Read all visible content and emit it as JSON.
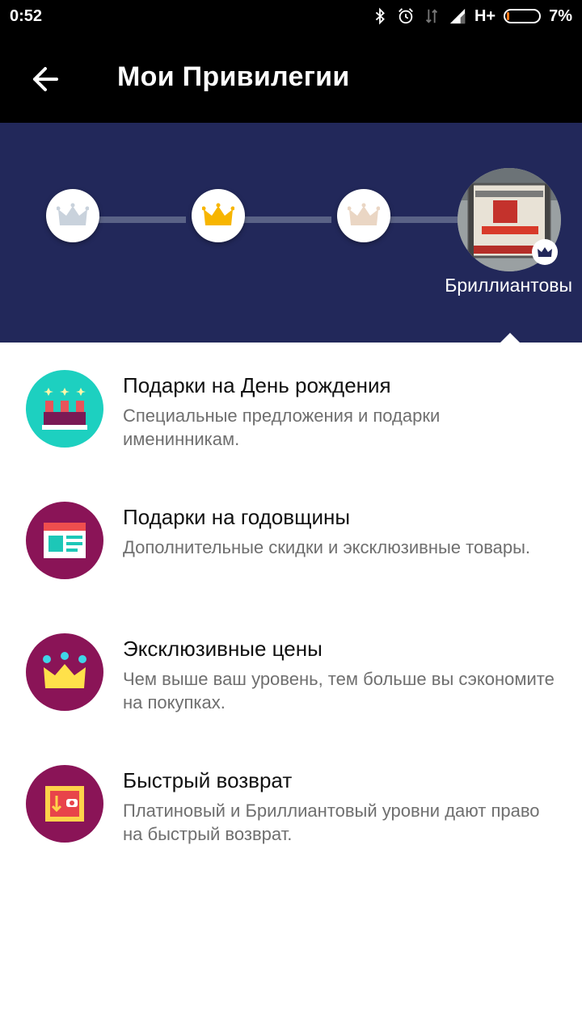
{
  "status_bar": {
    "time": "0:52",
    "network": "H+",
    "battery": "7%",
    "battery_level": 0.07,
    "icons": [
      "bluetooth-icon",
      "alarm-icon",
      "data-arrows-icon",
      "signal-icon",
      "battery-icon"
    ]
  },
  "app_bar": {
    "title": "Мои Привилегии",
    "back_icon": "arrow-left-icon"
  },
  "tiers": {
    "current_label": "Бриллиантовы",
    "nodes": [
      {
        "icon": "crown-silver-icon",
        "color": "#c9d2dc"
      },
      {
        "icon": "crown-gold-icon",
        "color": "#f7b500"
      },
      {
        "icon": "crown-platinum-icon",
        "color": "#ead6c4"
      },
      {
        "icon": "crown-diamond-icon",
        "color": "#22285a"
      }
    ],
    "banner_color": "#22285a"
  },
  "benefits": [
    {
      "title": "Подарки на День рождения",
      "description": "Специальные предложения и подарки именинникам.",
      "icon": "birthday-cake-icon",
      "icon_bg": "#1dd0c0"
    },
    {
      "title": "Подарки на годовщины",
      "description": "Дополнительные скидки и эксклюзивные товары.",
      "icon": "web-page-icon",
      "icon_bg": "#8a1457"
    },
    {
      "title": "Эксклюзивные цены",
      "description": "Чем выше ваш уровень, тем больше вы сэкономите на покупках.",
      "icon": "crown-icon",
      "icon_bg": "#8a1457"
    },
    {
      "title": "Быстрый возврат",
      "description": "Платиновый и Бриллиантовый уровни дают право на быстрый возврат.",
      "icon": "return-box-icon",
      "icon_bg": "#8a1457"
    }
  ]
}
